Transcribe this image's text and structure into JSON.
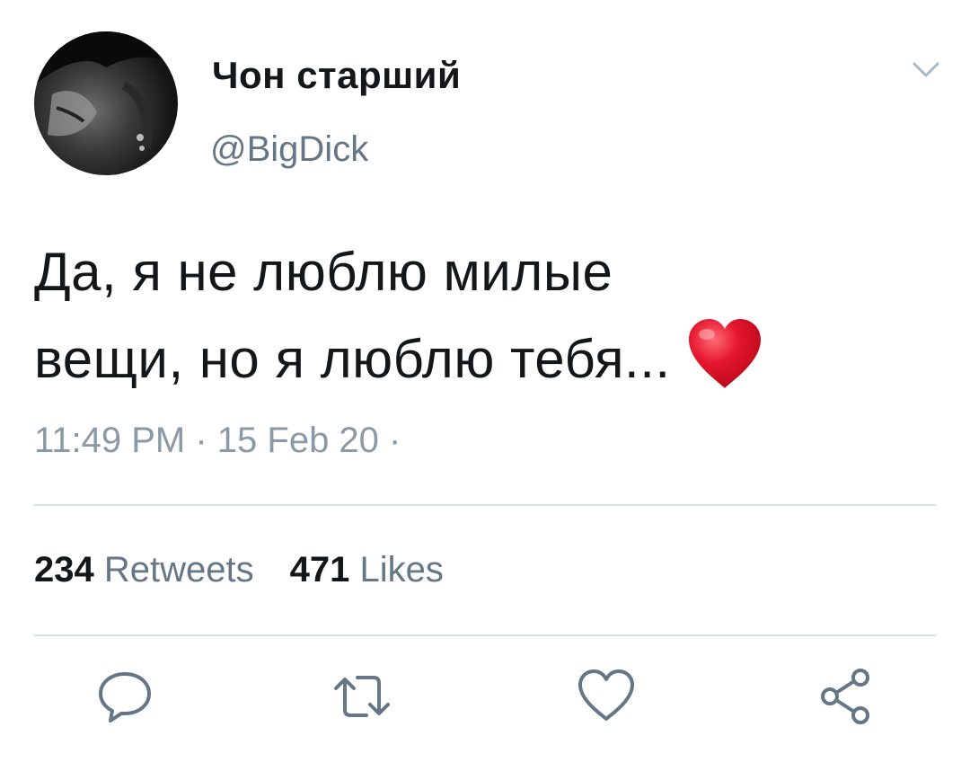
{
  "tweet": {
    "author": {
      "display_name": "Чон старший",
      "handle": "@BigDick"
    },
    "text_line1": "Да, я не люблю милые",
    "text_line2": "вещи, но я люблю тебя...",
    "emoji": "red-heart",
    "timestamp": "11:49 PM · 15 Feb 20 ·"
  },
  "stats": {
    "retweets_count": "234",
    "retweets_label": "Retweets",
    "likes_count": "471",
    "likes_label": "Likes"
  },
  "actions": [
    "reply-icon",
    "retweet-icon",
    "like-icon",
    "share-icon"
  ],
  "colors": {
    "text": "#14171a",
    "secondary": "#657786",
    "divider": "#d9e1e8",
    "heart_emoji": "#e5162e"
  }
}
